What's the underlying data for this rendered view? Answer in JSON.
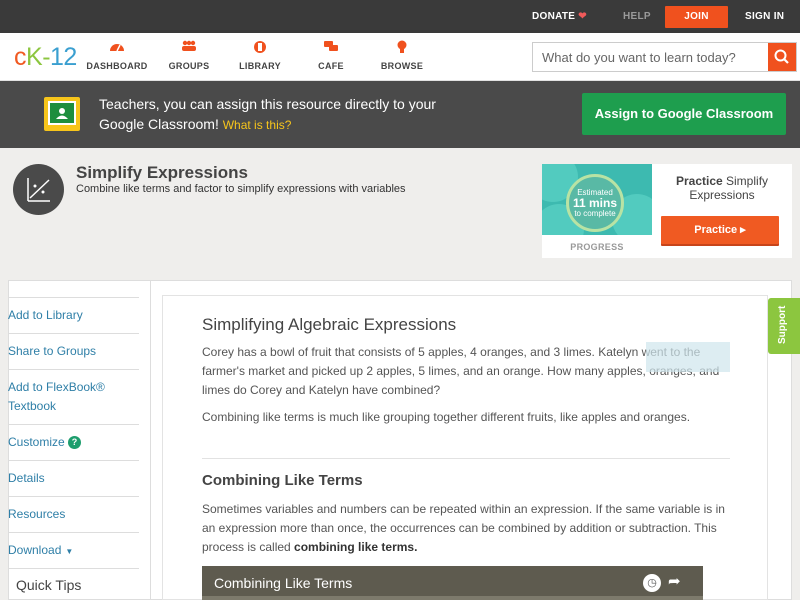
{
  "topbar": {
    "donate": "DONATE",
    "help": "HELP",
    "join": "JOIN",
    "signin": "SIGN IN"
  },
  "logo": {
    "c": "c",
    "k": "K",
    "dash": "-",
    "n": "12"
  },
  "nav": [
    {
      "label": "DASHBOARD",
      "icon": "dashboard-icon"
    },
    {
      "label": "GROUPS",
      "icon": "groups-icon"
    },
    {
      "label": "LIBRARY",
      "icon": "library-icon"
    },
    {
      "label": "CAFE",
      "icon": "cafe-icon"
    },
    {
      "label": "BROWSE",
      "icon": "browse-icon"
    }
  ],
  "search": {
    "placeholder": "What do you want to learn today?"
  },
  "banner": {
    "text": "Teachers, you can assign this resource directly to your Google Classroom!",
    "link": "What is this?",
    "button": "Assign to Google Classroom"
  },
  "concept": {
    "title": "Simplify Expressions",
    "description": "Combine like terms and factor to simplify expressions with variables"
  },
  "practice": {
    "estimated": "Estimated",
    "minutes": "11 mins",
    "to_complete": "to complete",
    "progress_label": "PROGRESS",
    "title_bold": "Practice",
    "title_rest": "Simplify Expressions",
    "button": "Practice"
  },
  "sidebar": {
    "items": [
      {
        "label": "Add to Library"
      },
      {
        "label": "Share to Groups"
      },
      {
        "label": "Add to FlexBook® Textbook"
      },
      {
        "label": "Customize"
      },
      {
        "label": "Details"
      },
      {
        "label": "Resources"
      },
      {
        "label": "Download"
      }
    ],
    "quick_tips": "Quick Tips"
  },
  "content": {
    "heading": "Simplifying Algebraic Expressions",
    "intro": "Corey has a bowl of fruit that consists of 5 apples, 4 oranges, and 3 limes. Katelyn went to the farmer's market and picked up 2 apples, 5 limes, and an orange. How many apples, oranges, and limes do Corey and Katelyn have combined?",
    "para2": "Combining like terms is much like grouping together different fruits, like apples and oranges.",
    "subheading": "Combining Like Terms",
    "para3_start": "Sometimes variables and numbers can be repeated within an expression. If the same variable is in an expression more than once, the occurrences can be combined by addition or subtraction. This process is called ",
    "para3_bold": "combining like terms.",
    "video_title": "Combining Like Terms"
  },
  "support": "Support",
  "colors": {
    "accent": "#f0511e",
    "green": "#1e9e4e",
    "link": "#2f7fa7",
    "support": "#8cc63f"
  }
}
